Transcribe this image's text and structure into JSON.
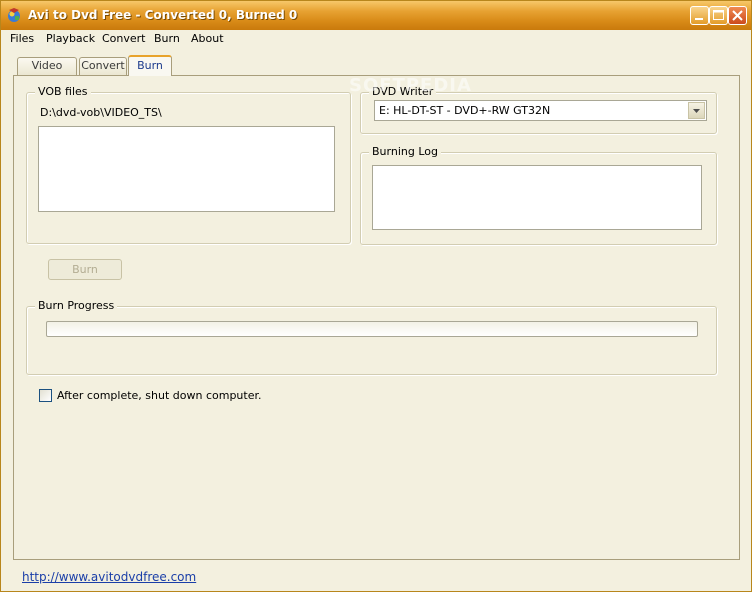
{
  "window": {
    "title": "Avi to Dvd Free - Converted 0, Burned 0"
  },
  "menu": [
    "Files",
    "Playback",
    "Convert",
    "Burn",
    "About"
  ],
  "tabs": [
    {
      "label": "Video Files",
      "active": false
    },
    {
      "label": "Convert",
      "active": false
    },
    {
      "label": "Burn",
      "active": true
    }
  ],
  "vob": {
    "group_label": "VOB files",
    "path": "D:\\dvd-vob\\VIDEO_TS\\"
  },
  "dvd_writer": {
    "group_label": "DVD Writer",
    "selected": "E: HL-DT-ST - DVD+-RW GT32N"
  },
  "burning_log": {
    "group_label": "Burning Log"
  },
  "burn_button": {
    "label": "Burn",
    "enabled": false
  },
  "burn_progress": {
    "group_label": "Burn Progress",
    "value": 0
  },
  "shutdown_checkbox": {
    "label": "After complete, shut down computer.",
    "checked": false
  },
  "footer_link": "http://www.avitodvdfree.com",
  "watermark": "SOFTPEDIA",
  "colors": {
    "titlebar": "#d88a17",
    "tab_active_accent": "#e8a32c",
    "link": "#1a3ea8",
    "background": "#f3f0df"
  }
}
